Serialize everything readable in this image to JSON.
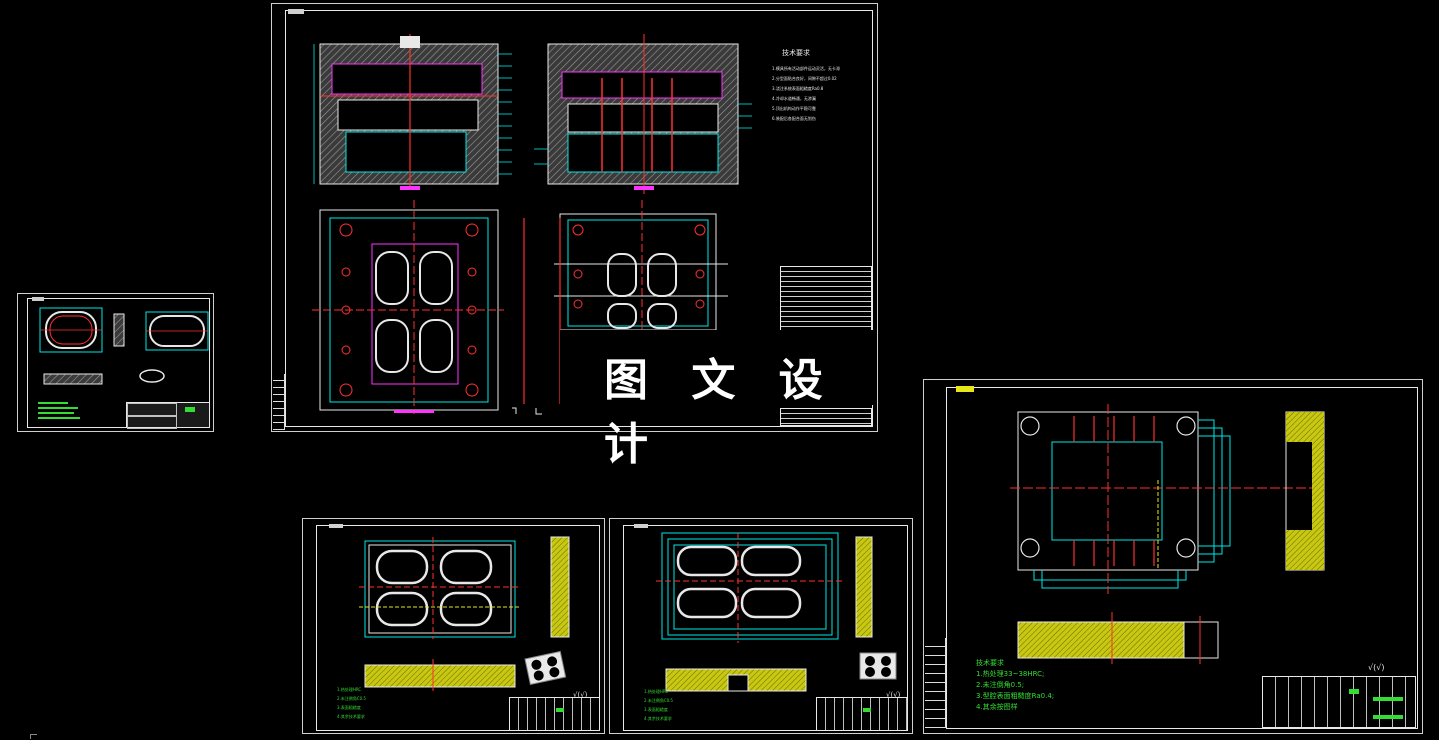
{
  "watermark": {
    "text": "图 文 设 计"
  },
  "sheet_main": {
    "tech_req_title": "技术要求",
    "tech_req_lines": [
      "1.模具所有活动部件运动灵活，无卡滞",
      "2.分型面贴合良好，间隙不超过0.02",
      "3.浇注系统表面粗糙度Ra0.8",
      "4.冷却水道畅通，无渗漏",
      "5.顶出机构动作平稳可靠",
      "6.装配后各配合面无划伤"
    ]
  },
  "sheet_cavity": {
    "notes": [
      "1.热处理HRC",
      "2.未注倒角C0.5",
      "3.表面粗糙度",
      "4.其余技术要求"
    ]
  },
  "sheet_core": {
    "notes": [
      "1.热处理HRC",
      "2.未注倒角C0.5",
      "3.表面粗糙度",
      "4.其余技术要求"
    ]
  },
  "sheet_plate": {
    "notes_title": "技术要求",
    "notes": [
      "1.热处理33~38HRC;",
      "2.未注倒角0.5;",
      "3.型腔表面粗糙度Ra0.4;",
      "4.其余按图样"
    ],
    "roughness": "√(√)"
  },
  "colors": {
    "background": "#000000",
    "frame": "#e8e8e8",
    "note_green": "#33dd33",
    "hatch_yellow": "#e6e61a",
    "cyan": "#00e6e6",
    "red": "#ff3030",
    "magenta": "#ff33ff"
  }
}
